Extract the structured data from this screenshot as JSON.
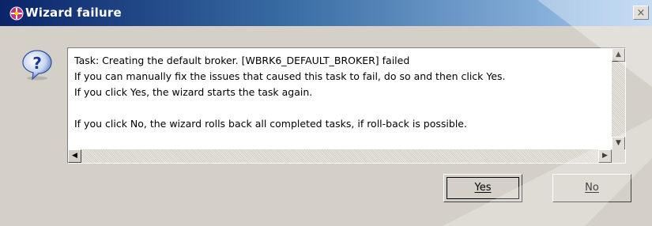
{
  "window": {
    "title": "Wizard failure",
    "close_label": "×"
  },
  "message": {
    "lines": [
      "Task: Creating the default broker. [WBRK6_DEFAULT_BROKER] failed",
      "If you can manually fix the issues that caused this task to fail, do so and then click Yes.",
      "If you click Yes, the wizard starts the task again.",
      "",
      "If you click No, the wizard rolls back all completed tasks, if roll-back is possible."
    ]
  },
  "buttons": {
    "yes_label": "Yes",
    "no_label": "No"
  },
  "icons": {
    "app": "wizard-icon",
    "dialog": "question-icon"
  },
  "colors": {
    "title_bar_start": "#0a246a",
    "title_bar_end": "#a6caf0",
    "dialog_face": "#d4d0c8"
  }
}
